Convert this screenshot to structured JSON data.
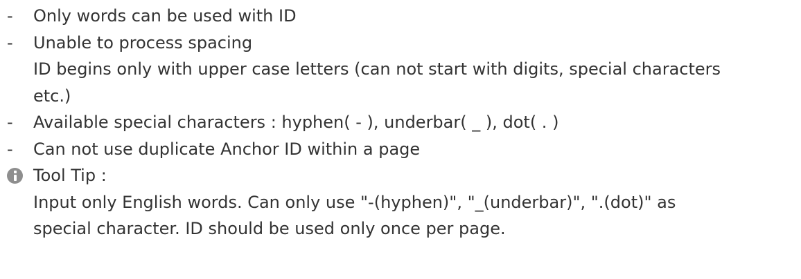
{
  "bullets": [
    {
      "dash": "-",
      "text": "Only words can be used with ID"
    },
    {
      "dash": "-",
      "text": "Unable to process spacing"
    }
  ],
  "continuation": {
    "line1": "ID begins only with upper case letters (can not start with digits, special characters",
    "line2": "etc.)"
  },
  "bullets2": [
    {
      "dash": "-",
      "text": "Available special characters : hyphen( - ), underbar( _ ), dot( . )"
    },
    {
      "dash": "-",
      "text": "Can not use duplicate Anchor ID within a page"
    }
  ],
  "tooltip": {
    "icon": "info-icon",
    "title": "Tool Tip :",
    "line1": "Input only English words. Can only use \"-(hyphen)\", \"_(underbar)\", \".(dot)\" as",
    "line2": "special character. ID should be used only once per page."
  }
}
